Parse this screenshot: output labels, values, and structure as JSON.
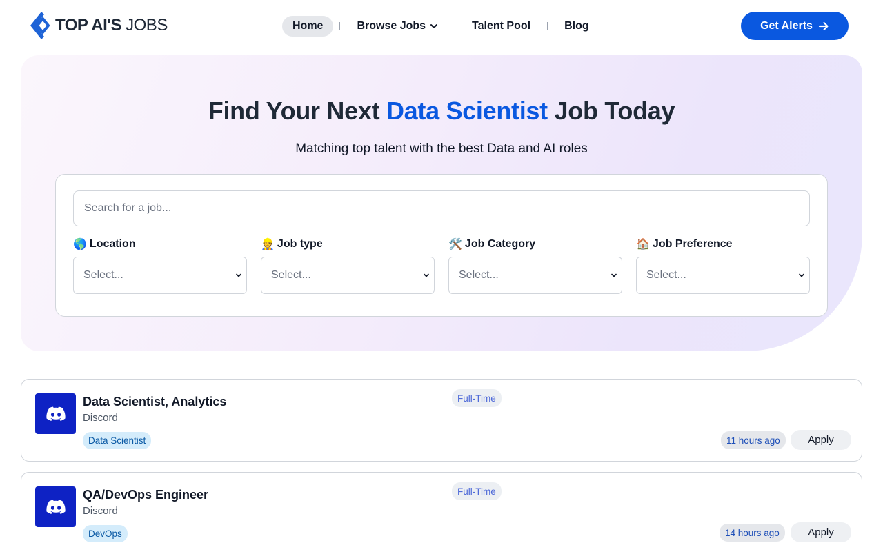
{
  "header": {
    "logo": {
      "bold": "TOP AI'S",
      "thin": " JOBS"
    },
    "nav": [
      {
        "label": "Home",
        "active": true
      },
      {
        "label": "Browse Jobs",
        "dropdown": true
      },
      {
        "label": "Talent Pool"
      },
      {
        "label": "Blog"
      }
    ],
    "cta": {
      "label": "Get Alerts",
      "icon": "arrow-right-icon"
    }
  },
  "hero": {
    "title_pre": "Find Your Next ",
    "title_accent": "Data Scientist",
    "title_post": " Job Today",
    "subtitle": "Matching top talent with the best Data and AI roles",
    "search_placeholder": "Search for a job...",
    "filters": [
      {
        "emoji": "🌎",
        "label": "Location",
        "value": "Select..."
      },
      {
        "emoji": "👷",
        "label": "Job type",
        "value": "Select..."
      },
      {
        "emoji": "🛠️",
        "label": "Job Category",
        "value": "Select..."
      },
      {
        "emoji": "🏠",
        "label": "Job Preference",
        "value": "Select..."
      }
    ]
  },
  "jobs": [
    {
      "title": "Data Scientist, Analytics",
      "company": "Discord",
      "tag": "Data Scientist",
      "type": "Full-Time",
      "posted": "11 hours ago",
      "apply": "Apply",
      "logo_icon": "discord-icon"
    },
    {
      "title": "QA/DevOps Engineer",
      "company": "Discord",
      "tag": "DevOps",
      "type": "Full-Time",
      "posted": "14 hours ago",
      "apply": "Apply",
      "logo_icon": "discord-icon"
    }
  ],
  "colors": {
    "brand": "#0a58e0",
    "discord_logo_bg": "#0e22c4",
    "tag_bg": "#d4ecfb"
  }
}
